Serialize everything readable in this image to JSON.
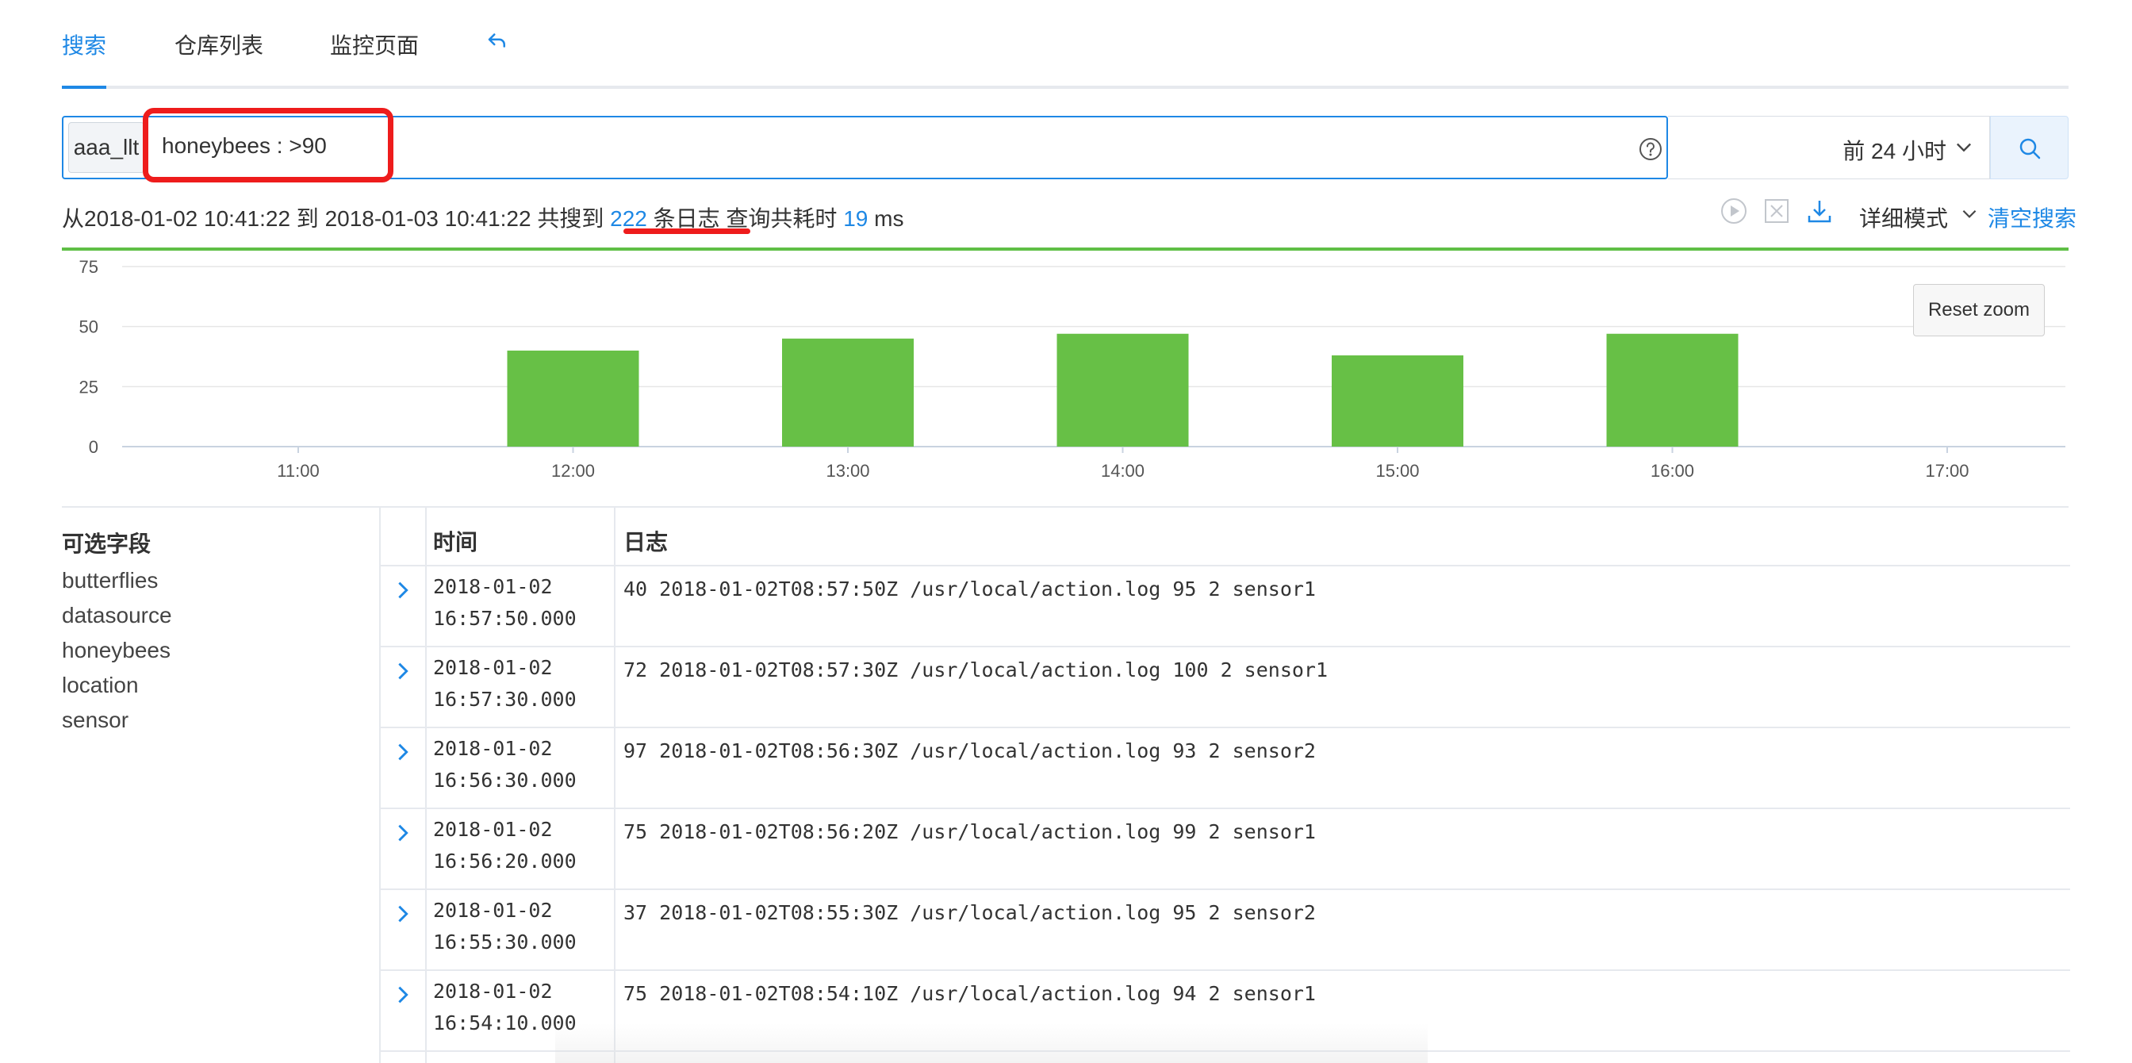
{
  "tabs": [
    {
      "label": "搜索"
    },
    {
      "label": "仓库列表"
    },
    {
      "label": "监控页面"
    }
  ],
  "search": {
    "repo": "aaa_llt",
    "query": "honeybees : >90",
    "time_range": "前 24 小时"
  },
  "summary": {
    "prefix": "从",
    "start": "2018-01-02 10:41:22",
    "to": " 到 ",
    "end": "2018-01-03 10:41:22",
    "found": " 共搜到 ",
    "count": "222",
    "unit": " 条日志",
    "cost_label": " 查询共耗时 ",
    "cost": "19",
    "cost_unit": " ms"
  },
  "toolbar": {
    "detail_mode": "详细模式",
    "clear_search": "清空搜索",
    "reset_zoom": "Reset zoom"
  },
  "chart_data": {
    "type": "bar",
    "categories": [
      "11:00",
      "12:00",
      "13:00",
      "14:00",
      "15:00",
      "16:00",
      "17:00"
    ],
    "values": [
      0,
      40,
      45,
      47,
      38,
      47,
      0
    ],
    "ylim": [
      0,
      75
    ],
    "yticks": [
      "0",
      "25",
      "50",
      "75"
    ],
    "color": "#67c046",
    "grid": true
  },
  "fields": {
    "title": "可选字段",
    "items": [
      "butterflies",
      "datasource",
      "honeybees",
      "location",
      "sensor"
    ]
  },
  "table": {
    "headers": [
      "时间",
      "日志"
    ],
    "rows": [
      {
        "date": "2018-01-02",
        "time": "16:57:50.000",
        "log": "40 2018-01-02T08:57:50Z /usr/local/action.log 95 2 sensor1"
      },
      {
        "date": "2018-01-02",
        "time": "16:57:30.000",
        "log": "72 2018-01-02T08:57:30Z /usr/local/action.log 100 2 sensor1"
      },
      {
        "date": "2018-01-02",
        "time": "16:56:30.000",
        "log": "97 2018-01-02T08:56:30Z /usr/local/action.log 93 2 sensor2"
      },
      {
        "date": "2018-01-02",
        "time": "16:56:20.000",
        "log": "75 2018-01-02T08:56:20Z /usr/local/action.log 99 2 sensor1"
      },
      {
        "date": "2018-01-02",
        "time": "16:55:30.000",
        "log": "37 2018-01-02T08:55:30Z /usr/local/action.log 95 2 sensor2"
      },
      {
        "date": "2018-01-02",
        "time": "16:54:10.000",
        "log": "75 2018-01-02T08:54:10Z /usr/local/action.log 94 2 sensor1"
      }
    ]
  },
  "colors": {
    "accent": "#1e88e5",
    "bar": "#67c046",
    "annotation": "#ee1c1c"
  }
}
